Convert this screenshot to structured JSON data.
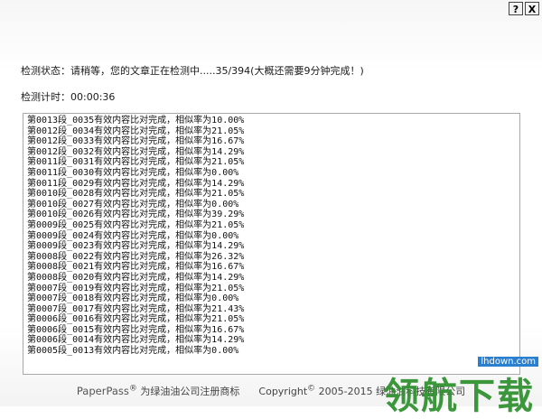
{
  "window": {
    "help_label": "?",
    "close_label": "X"
  },
  "status": {
    "label": "检测状态：",
    "message": "请稍等，您的文章正在检测中.....35/394(大概还需要9分钟完成！)"
  },
  "timer": {
    "label": "检测计时：",
    "value": "00:00:36"
  },
  "log": [
    "第0013段_0035有效内容比对完成，相似率为10.00%",
    "第0012段_0034有效内容比对完成，相似率为21.05%",
    "第0012段_0033有效内容比对完成，相似率为16.67%",
    "第0012段_0032有效内容比对完成，相似率为14.29%",
    "第0011段_0031有效内容比对完成，相似率为21.05%",
    "第0011段_0030有效内容比对完成，相似率为0.00%",
    "第0011段_0029有效内容比对完成，相似率为14.29%",
    "第0010段_0028有效内容比对完成，相似率为21.05%",
    "第0010段_0027有效内容比对完成，相似率为0.00%",
    "第0010段_0026有效内容比对完成，相似率为39.29%",
    "第0009段_0025有效内容比对完成，相似率为21.05%",
    "第0009段_0024有效内容比对完成，相似率为0.00%",
    "第0009段_0023有效内容比对完成，相似率为14.29%",
    "第0008段_0022有效内容比对完成，相似率为26.32%",
    "第0008段_0021有效内容比对完成，相似率为16.67%",
    "第0008段_0020有效内容比对完成，相似率为14.29%",
    "第0007段_0019有效内容比对完成，相似率为21.05%",
    "第0007段_0018有效内容比对完成，相似率为0.00%",
    "第0007段_0017有效内容比对完成，相似率为21.43%",
    "第0006段_0016有效内容比对完成，相似率为21.05%",
    "第0006段_0015有效内容比对完成，相似率为16.67%",
    "第0006段_0014有效内容比对完成，相似率为14.29%",
    "第0005段_0013有效内容比对完成，相似率为0.00%"
  ],
  "footer": {
    "brand": "PaperPass",
    "registered_mark": "®",
    "trademark_text": "为绿油油公司注册商标",
    "copyright_label": "Copyright",
    "copyright_symbol": "©",
    "copyright_text": "2005-2015 绿油油科技有限公司"
  },
  "watermark": {
    "url": "lhdown.com",
    "brand": "领航下载"
  }
}
